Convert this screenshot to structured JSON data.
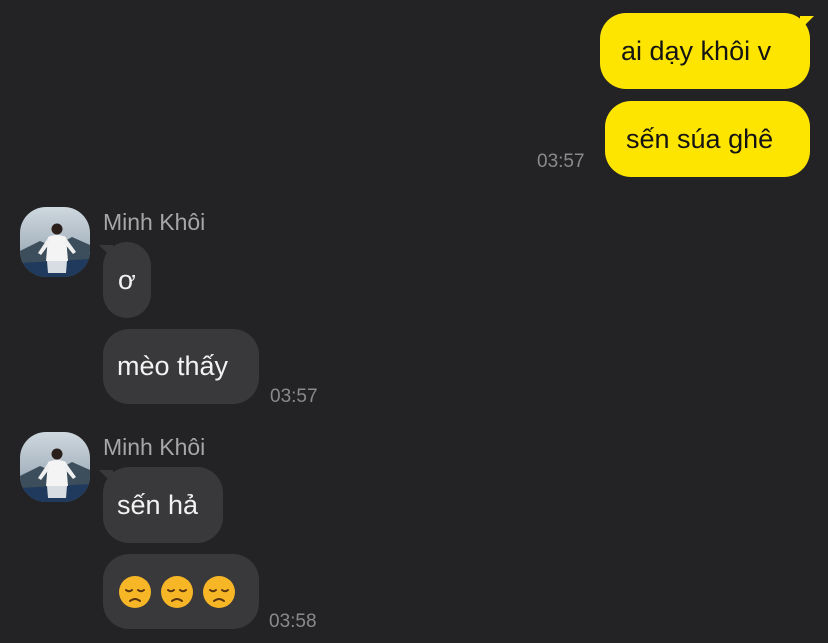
{
  "messages_out": {
    "msg1": "ai dạy khôi v",
    "msg2": "sến súa ghê",
    "time": "03:57"
  },
  "group1": {
    "sender": "Minh Khôi",
    "msg1": "ơ",
    "msg2": "mèo thấy",
    "time": "03:57"
  },
  "group2": {
    "sender": "Minh Khôi",
    "msg1": "sến hả",
    "emoji_count": 3,
    "emoji_name": "disappointed-face",
    "time": "03:58"
  },
  "colors": {
    "background": "#232325",
    "outgoing_bubble": "#fee500",
    "incoming_bubble": "#39393b",
    "timestamp": "#8a8a8c"
  }
}
